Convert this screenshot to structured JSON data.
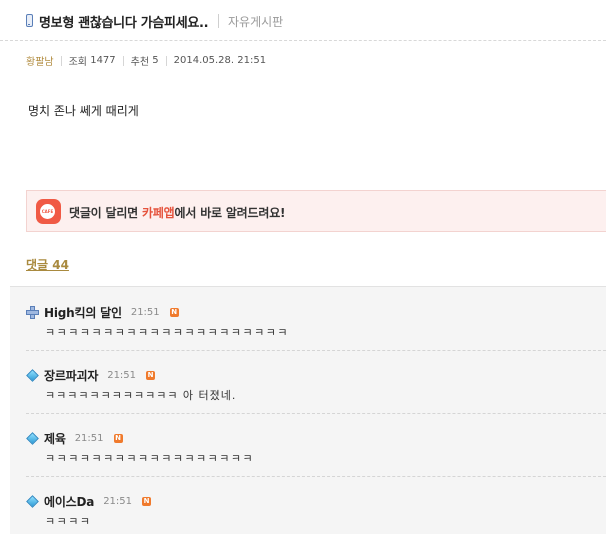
{
  "post": {
    "title": "명보형 괜찮습니다 가슴피세요..",
    "board": "자유게시판",
    "author": "황팔남",
    "views_label": "조회",
    "views": "1477",
    "recommend_label": "추천",
    "recommends": "5",
    "datetime": "2014.05.28. 21:51",
    "body": "명치 존나 쎄게 때리게"
  },
  "banner": {
    "icon_text": "CAFE",
    "text_before": "댓글이 달리면 ",
    "text_accent": "카페앱",
    "text_after": "에서 바로 알려드려요!",
    "accent_color": "#e5533d"
  },
  "comments_header": {
    "label": "댓글 44"
  },
  "comments": [
    {
      "nickname": "High킥의 달인",
      "time": "21:51",
      "badge": "N",
      "level_icon": "cross-level-icon",
      "text": "ㅋㅋㅋㅋㅋㅋㅋㅋㅋㅋㅋㅋㅋㅋㅋㅋㅋㅋㅋㅋㅋ"
    },
    {
      "nickname": "장르파괴자",
      "time": "21:51",
      "badge": "N",
      "level_icon": "diamond-level-icon",
      "text": "ㅋㅋㅋㅋㅋㅋㅋㅋㅋㅋㅋㅋ 아 터졌네."
    },
    {
      "nickname": "제육",
      "time": "21:51",
      "badge": "N",
      "level_icon": "diamond-level-icon",
      "text": "ㅋㅋㅋㅋㅋㅋㅋㅋㅋㅋㅋㅋㅋㅋㅋㅋㅋㅋ"
    },
    {
      "nickname": "에이스Da",
      "time": "21:51",
      "badge": "N",
      "level_icon": "diamond-level-icon",
      "text": "ㅋㅋㅋㅋ"
    }
  ]
}
